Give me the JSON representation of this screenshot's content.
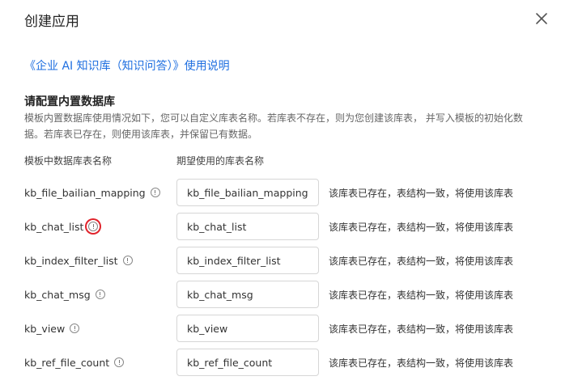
{
  "dialog": {
    "title": "创建应用",
    "close_icon": "close-icon"
  },
  "doc_link": "《企业 AI 知识库（知识问答）》使用说明",
  "section": {
    "title": "请配置内置数据库",
    "description": "模板内置数据库使用情况如下，您可以自定义库表名称。若库表不存在，则为您创建该库表， 并写入模板的初始化数据。若库表已存在，则使用该库表，并保留已有数据。"
  },
  "columns": {
    "template_name": "模板中数据库表名称",
    "desired_name": "期望使用的库表名称"
  },
  "rows": [
    {
      "name": "kb_file_bailian_mapping",
      "value": "kb_file_bailian_mapping",
      "status": "该库表已存在，表结构一致，将使用该库表"
    },
    {
      "name": "kb_chat_list",
      "value": "kb_chat_list",
      "status": "该库表已存在，表结构一致，将使用该库表"
    },
    {
      "name": "kb_index_filter_list",
      "value": "kb_index_filter_list",
      "status": "该库表已存在，表结构一致，将使用该库表"
    },
    {
      "name": "kb_chat_msg",
      "value": "kb_chat_msg",
      "status": "该库表已存在，表结构一致，将使用该库表"
    },
    {
      "name": "kb_view",
      "value": "kb_view",
      "status": "该库表已存在，表结构一致，将使用该库表"
    },
    {
      "name": "kb_ref_file_count",
      "value": "kb_ref_file_count",
      "status": "该库表已存在，表结构一致，将使用该库表"
    }
  ],
  "colors": {
    "link": "#1f6fe0",
    "highlight_ring": "#e0232b"
  }
}
